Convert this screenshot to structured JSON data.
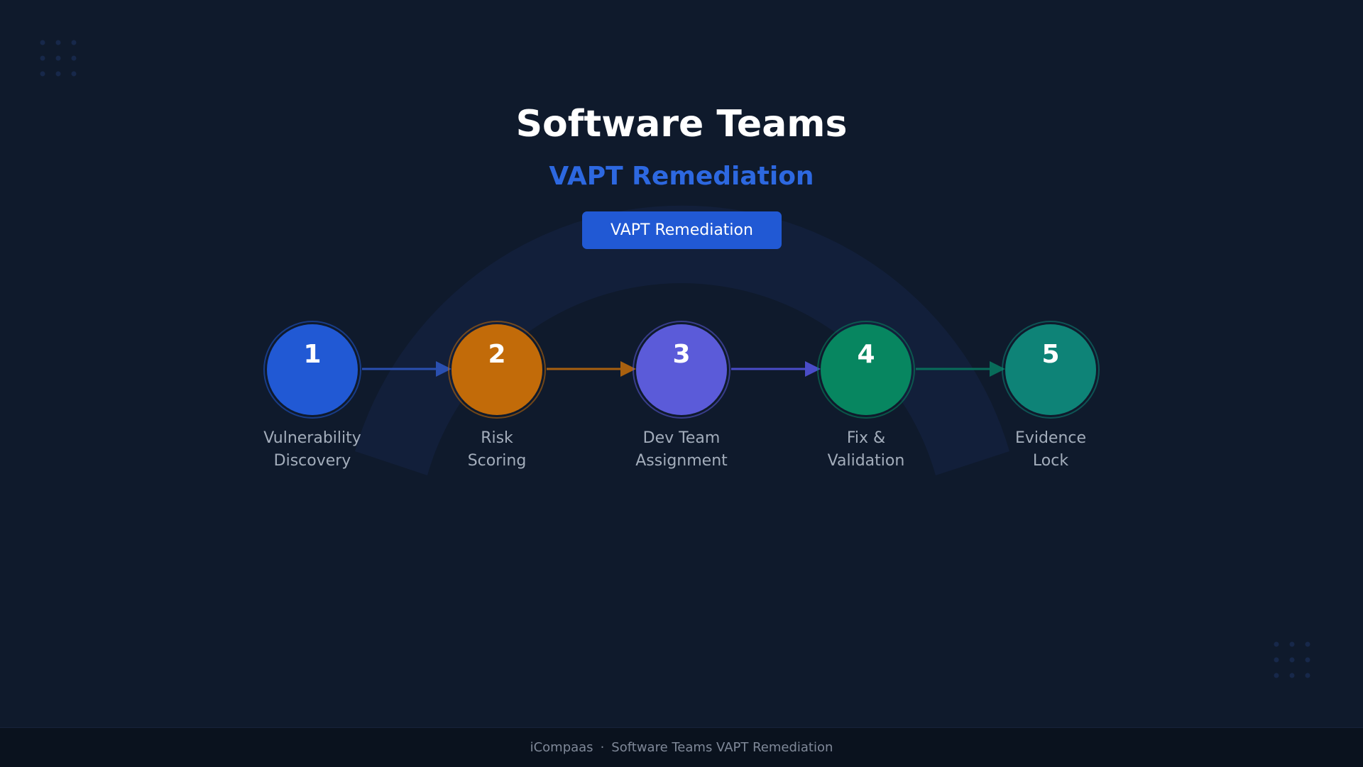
{
  "header": {
    "title": "Software Teams",
    "subtitle": "VAPT Remediation",
    "badge_label": "VAPT Remediation"
  },
  "steps": [
    {
      "number": "1",
      "label_line1": "Vulnerability",
      "label_line2": "Discovery",
      "color": "#2159d4"
    },
    {
      "number": "2",
      "label_line1": "Risk",
      "label_line2": "Scoring",
      "color": "#c26b09"
    },
    {
      "number": "3",
      "label_line1": "Dev Team",
      "label_line2": "Assignment",
      "color": "#5b5bd9"
    },
    {
      "number": "4",
      "label_line1": "Fix &",
      "label_line2": "Validation",
      "color": "#078660"
    },
    {
      "number": "5",
      "label_line1": "Evidence",
      "label_line2": "Lock",
      "color": "#0e8377"
    }
  ],
  "connector_colors": [
    "#2a4fb0",
    "#a8600f",
    "#4a4cc8",
    "#086c5a"
  ],
  "footer": {
    "brand": "iCompaas",
    "separator": "·",
    "text": "Software Teams VAPT Remediation"
  },
  "colors": {
    "background": "#0f1a2c",
    "arc": "#121f3a",
    "accent": "#2d68e0"
  }
}
